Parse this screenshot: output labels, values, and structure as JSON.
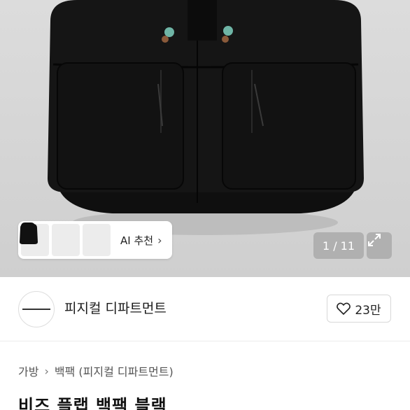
{
  "hero": {
    "image_subject": "black backpack with beads",
    "thumbnails": [
      "backpack-front",
      "backpack-flap",
      "backpack-angle"
    ],
    "ai_label": "AI 추천",
    "counter": "1 / 11"
  },
  "seller": {
    "name": "피지컬 디파트먼트",
    "like_count": "23만"
  },
  "breadcrumb": {
    "level1": "가방",
    "level2": "백팩 (피지컬 디파트먼트)"
  },
  "product": {
    "title": "비즈 플랩 백팩 블랙"
  },
  "colors": {
    "bag": "#111111",
    "background": "#d6d6d6",
    "bead_teal": "#6fb5a6",
    "bead_brown": "#8a5a3a"
  }
}
